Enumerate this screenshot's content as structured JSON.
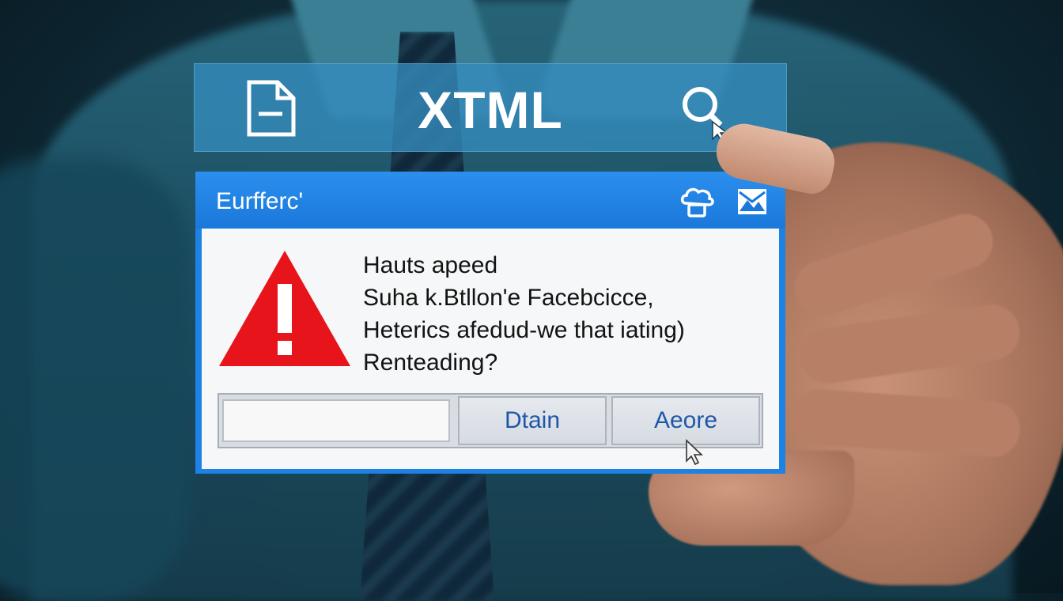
{
  "toolbar": {
    "app_title": "XTML",
    "left_icon": "document-icon",
    "right_icon": "search-icon"
  },
  "dialog": {
    "title": "Eurfferc'",
    "header_icons": [
      "cloud-icon",
      "image-icon"
    ],
    "warning_icon": "warning-triangle-icon",
    "message_lines": [
      "Hauts apeed",
      "Suha k.Btllon'e Facebcicce,",
      "Heterics afedud-we that iating)",
      "Renteading?"
    ],
    "input_value": "",
    "buttons": [
      "Dtain",
      "Aeore"
    ]
  },
  "colors": {
    "accent": "#1d82e4",
    "toolbar": "#348cbe",
    "warning": "#e8141c",
    "button_text": "#1f57a8"
  }
}
